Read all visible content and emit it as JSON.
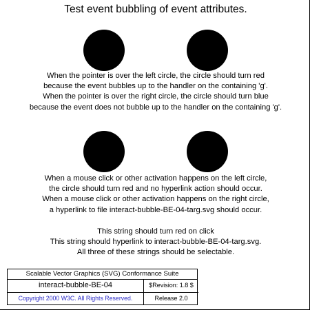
{
  "title": "Test event bubbling of event attributes.",
  "circles": [
    {
      "label": "left circle (bubbling)"
    },
    {
      "label": "right circle (non-bubbling)"
    },
    {
      "label": "left circle (activation)"
    },
    {
      "label": "right circle (hyperlink)"
    }
  ],
  "paragraph1": [
    "When the pointer is over the left circle, the circle should turn red",
    "because the event bubbles up to the handler on the containing 'g'.",
    "When the pointer is over the right circle, the circle should turn blue",
    "because the event does not bubble up to the handler on the containing 'g'."
  ],
  "paragraph2": [
    "When a mouse click or other activation happens on the left circle,",
    "the circle should turn red and no hyperlink action should occur.",
    "When a mouse click or other activation happens on the right circle,",
    "a hyperlink to file interact-bubble-BE-04-targ.svg should occur."
  ],
  "strings": {
    "red_on_click": "This string should turn red on click",
    "hyperlink": "This string should hyperlink to interact-bubble-BE-04-targ.svg.",
    "selectable": "All three of these strings should be selectable."
  },
  "footer": {
    "suite": "Scalable Vector Graphics (SVG) Conformance Suite",
    "test_name": "interact-bubble-BE-04",
    "revision": "$Revision: 1.8 $",
    "copyright": "Copyright 2000 W3C. All Rights Reserved.",
    "release": "Release 2.0"
  },
  "colors": {
    "circle_fill": "#000000",
    "copyright_text": "#2b2bc8"
  }
}
